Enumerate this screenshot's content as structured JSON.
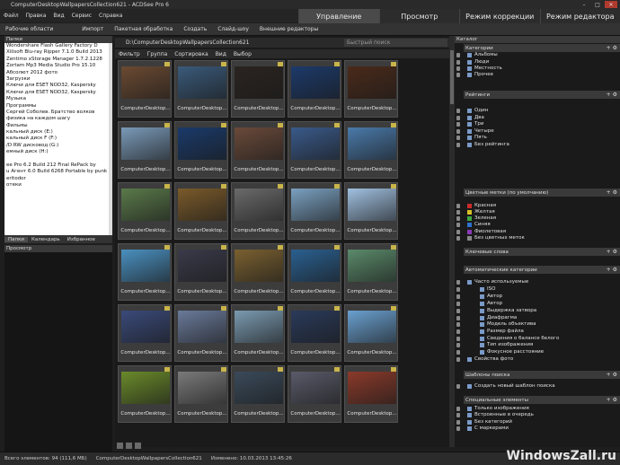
{
  "window": {
    "title": "ComputerDesktopWallpapersCollection621 - ACDSee Pro 6"
  },
  "menu": [
    "Файл",
    "Правка",
    "Вид",
    "Сервис",
    "Справка"
  ],
  "modes": [
    {
      "label": "Управление",
      "active": true
    },
    {
      "label": "Просмотр"
    },
    {
      "label": "Режим коррекции"
    },
    {
      "label": "Режим редактора"
    }
  ],
  "toolbar": [
    "Рабочие области",
    "Импорт",
    "Пакетная обработка",
    "Создать",
    "Слайд-шоу",
    "Внешние редакторы"
  ],
  "folders": {
    "title": "Папки",
    "items": [
      "Wondershare Flash Gallery Factory D",
      "Xilisoft Blu-ray Ripper 7.1.0 Build 2013",
      "Zentimo xStorage Manager 1.7.2.1228",
      "Zortam Mp3 Media Studio Pro 15.10",
      "Абсолют 2012 фото",
      "Загрузки",
      "Ключи для ESET NOD32, Kaspersky",
      "Ключи для ESET NOD32, Kaspersky",
      "Музыка",
      "Программы",
      "Сергей Соболев. Братство волков",
      "физика на каждом шагу",
      "Фильмы",
      "кальный диск (E:)",
      "кальный диск F (F:)",
      "/D RW дисковод (G:)",
      "емный диск (H:)",
      "",
      "ee Pro 6.2 Build 212 Final RePack by",
      "u Агент 6.0 Build 6268 Portable by punk",
      "eritodor",
      "отеки"
    ]
  },
  "left_tabs": [
    "Папки",
    "Календарь",
    "Избранное"
  ],
  "preview": {
    "title": "Просмотр"
  },
  "path": {
    "value": "D:\\ComputerDesktopWallpapersCollection621",
    "search_placeholder": "Быстрый поиск"
  },
  "filterbar": [
    "Фильтр",
    "Группа",
    "Сортировка",
    "Вид",
    "Выбор"
  ],
  "thumb_label": "ComputerDesktop...",
  "thumbs": [
    [
      "#6b4a32",
      "#3a5a7a",
      "#2a2420",
      "#1c3a6a",
      "#4a2a1a"
    ],
    [
      "#7a9ab8",
      "#1a3a6a",
      "#6a4a3a",
      "#3a5a8a",
      "#4a7aaa"
    ],
    [
      "#5a7a4a",
      "#7a5a2a",
      "#6a6a6a",
      "#7aa0c0",
      "#a0c0e0"
    ],
    [
      "#4a90c0",
      "#3a3a4a",
      "#7a6030",
      "#2a6090",
      "#5a8a6a"
    ],
    [
      "#3a4a7a",
      "#6a7a9a",
      "#7a9ab0",
      "#2a3a5a",
      "#6aa0d0"
    ],
    [
      "#6a8a2a",
      "#7a7a7a",
      "#3a4a5a",
      "#5a5a6a",
      "#8a3a2a"
    ]
  ],
  "catalog": {
    "title": "Каталог",
    "sections": [
      {
        "label": "Категории",
        "items": [
          "Альбомы",
          "Люди",
          "Местность",
          "Прочее"
        ]
      },
      {
        "label": "Рейтинги",
        "items": [
          "Один",
          "Два",
          "Три",
          "Четыре",
          "Пять",
          "Без рейтинга"
        ]
      },
      {
        "label": "Цветные метки (по умолчанию)",
        "items": [
          "Красная",
          "Желтая",
          "Зеленая",
          "Синяя",
          "Фиолетовая",
          "Без цветных меток"
        ]
      },
      {
        "label": "Ключевые слова",
        "items": []
      },
      {
        "label": "Автоматические категории",
        "items": [
          "Часто используемые",
          "ISO",
          "Автор",
          "Автор",
          "Выдержка затвора",
          "Диафрагма",
          "Модель объектива",
          "Размер файла",
          "Сведения о балансе белого",
          "Тип изображения",
          "Фокусное расстояние",
          "Свойства фото"
        ]
      },
      {
        "label": "Шаблоны поиска",
        "items": [
          "Создать новый шаблон поиска"
        ]
      },
      {
        "label": "Специальные элементы",
        "items": [
          "Только изображения",
          "Встроенные в очередь",
          "Без категорий",
          "С маркерами"
        ]
      }
    ]
  },
  "colors": {
    "accent": "#c9b44a",
    "red": "#cc2b2b",
    "yellow": "#d6c028",
    "green": "#3ea840",
    "blue": "#2e6fd0",
    "purple": "#8a3ab8"
  },
  "status": {
    "total": "Всего элементов: 94 (111,6 МБ)",
    "file": "ComputerDesktopWallpapersCollection621",
    "modified": "Изменено: 10.03.2013 13:45:26"
  },
  "watermark": "WindowsZall.ru"
}
